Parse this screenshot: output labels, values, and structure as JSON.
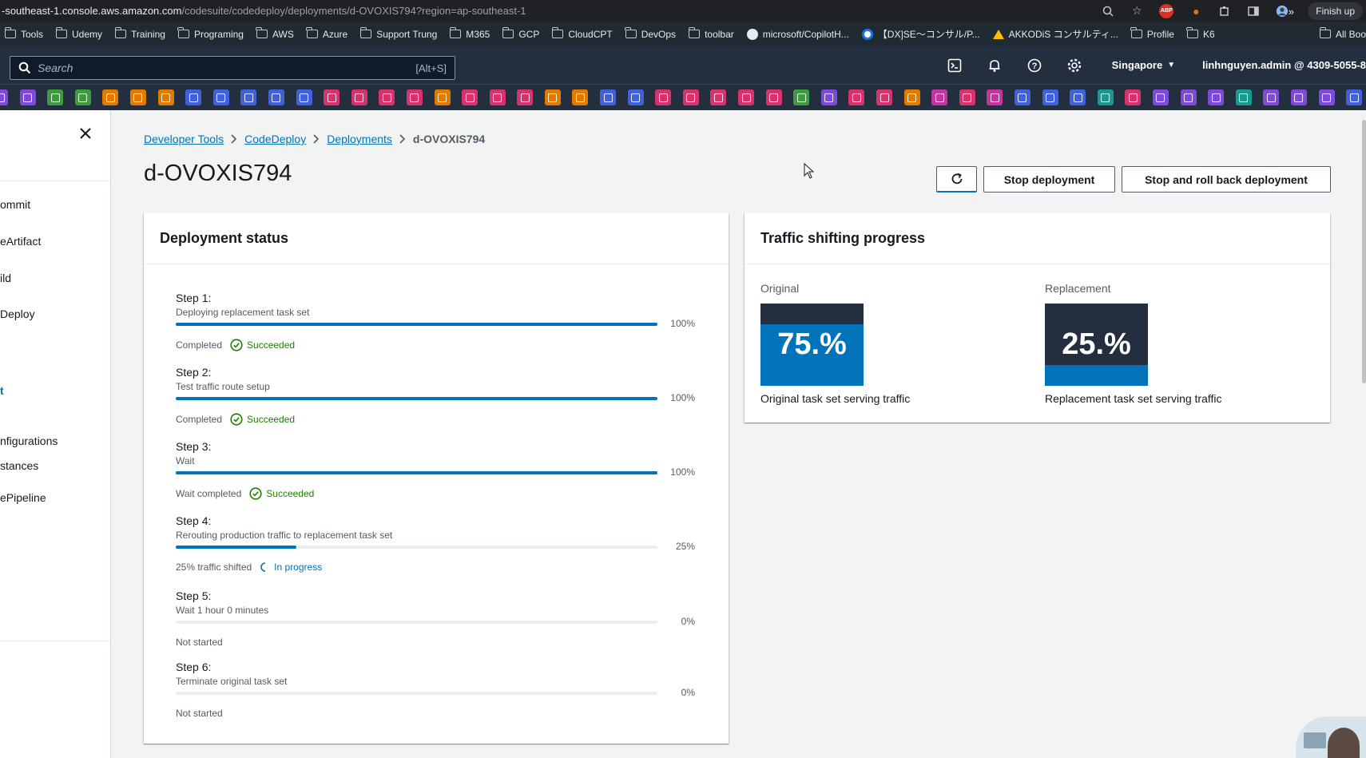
{
  "browser": {
    "url_host": "-southeast-1.console.aws.amazon.com",
    "url_path": "/codesuite/codedeploy/deployments/d-OVOXIS794?region=ap-southeast-1",
    "finish_label": "Finish up",
    "bookmarks": [
      {
        "label": "Tools",
        "icon": "folder-icon"
      },
      {
        "label": "Udemy",
        "icon": "folder-icon"
      },
      {
        "label": "Training",
        "icon": "folder-icon"
      },
      {
        "label": "Programing",
        "icon": "folder-icon"
      },
      {
        "label": "AWS",
        "icon": "folder-icon"
      },
      {
        "label": "Azure",
        "icon": "folder-icon"
      },
      {
        "label": "Support Trung",
        "icon": "folder-icon"
      },
      {
        "label": "M365",
        "icon": "folder-icon"
      },
      {
        "label": "GCP",
        "icon": "folder-icon"
      },
      {
        "label": "CloudCPT",
        "icon": "folder-icon"
      },
      {
        "label": "DevOps",
        "icon": "folder-icon"
      },
      {
        "label": "toolbar",
        "icon": "folder-icon"
      },
      {
        "label": "microsoft/CopilotH...",
        "icon": "github-icon"
      },
      {
        "label": "【DX]SE～コンサル/P...",
        "icon": "site-icon"
      },
      {
        "label": "AKKODiS コンサルティ...",
        "icon": "drive-icon"
      },
      {
        "label": "Profile",
        "icon": "folder-icon"
      },
      {
        "label": "K6",
        "icon": "folder-icon"
      }
    ],
    "more_label": "»",
    "all_bookmarks_label": "All Bookmarks"
  },
  "aws_header": {
    "search_placeholder": "Search",
    "search_shortcut": "[Alt+S]",
    "region": "Singapore",
    "account": "linhnguyen.admin @ 4309-5055-8",
    "fav_colors": [
      "#7d4bd6",
      "#7d4bd6",
      "#3f9b3f",
      "#3f9b3f",
      "#e07b00",
      "#e07b00",
      "#e07b00",
      "#4161d8",
      "#4161d8",
      "#4161d8",
      "#4161d8",
      "#4161d8",
      "#d6336c",
      "#d6336c",
      "#d6336c",
      "#d6336c",
      "#e07b00",
      "#d6336c",
      "#d6336c",
      "#d6336c",
      "#e07b00",
      "#e07b00",
      "#4161d8",
      "#4161d8",
      "#d6336c",
      "#d6336c",
      "#d6336c",
      "#d6336c",
      "#d6336c",
      "#3f9b3f",
      "#7d4bd6",
      "#d6336c",
      "#d6336c",
      "#e07b00",
      "#c2369c",
      "#d6336c",
      "#c2369c",
      "#4161d8",
      "#4161d8",
      "#4161d8",
      "#1a9a8f",
      "#d6336c",
      "#7d4bd6",
      "#7d4bd6",
      "#7d4bd6",
      "#1a9a8f",
      "#7d4bd6",
      "#7d4bd6",
      "#7d4bd6",
      "#4161d8"
    ]
  },
  "sidebar": {
    "items": [
      {
        "label": "ommit",
        "active": false
      },
      {
        "label": "eArtifact",
        "active": false
      },
      {
        "label": "ild",
        "active": false
      },
      {
        "label": "Deploy",
        "active": false
      },
      {
        "label": "t",
        "active": true
      },
      {
        "label": "nfigurations",
        "active": false
      },
      {
        "label": "stances",
        "active": false
      },
      {
        "label": "ePipeline",
        "active": false
      }
    ]
  },
  "breadcrumb": {
    "items": [
      "Developer Tools",
      "CodeDeploy",
      "Deployments"
    ],
    "current": "d-OVOXIS794"
  },
  "page": {
    "title": "d-OVOXIS794",
    "stop_label": "Stop deployment",
    "rollback_label": "Stop and roll back deployment"
  },
  "status_panel": {
    "title": "Deployment status",
    "steps": [
      {
        "title": "Step 1:",
        "desc": "Deploying replacement task set",
        "progress": 100,
        "pct": "100%",
        "status": "Completed",
        "result": "Succeeded",
        "state": "success"
      },
      {
        "title": "Step 2:",
        "desc": "Test traffic route setup",
        "progress": 100,
        "pct": "100%",
        "status": "Completed",
        "result": "Succeeded",
        "state": "success"
      },
      {
        "title": "Step 3:",
        "desc": "Wait",
        "progress": 100,
        "pct": "100%",
        "status": "Wait completed",
        "result": "Succeeded",
        "state": "success"
      },
      {
        "title": "Step 4:",
        "desc": "Rerouting production traffic to replacement task set",
        "progress": 25,
        "pct": "25%",
        "status": "25% traffic shifted",
        "result": "In progress",
        "state": "progress"
      },
      {
        "title": "Step 5:",
        "desc": "Wait 1 hour 0 minutes",
        "progress": 0,
        "pct": "0%",
        "status": "Not started",
        "result": "",
        "state": "none"
      },
      {
        "title": "Step 6:",
        "desc": "Terminate original task set",
        "progress": 0,
        "pct": "0%",
        "status": "Not started",
        "result": "",
        "state": "none"
      }
    ]
  },
  "traffic_panel": {
    "title": "Traffic shifting progress",
    "original": {
      "label": "Original",
      "value": "75.%",
      "fraction": 0.75,
      "caption": "Original task set serving traffic"
    },
    "replacement": {
      "label": "Replacement",
      "value": "25.%",
      "fraction": 0.25,
      "caption": "Replacement task set serving traffic"
    }
  },
  "colors": {
    "link": "#0073bb",
    "success": "#1d8102",
    "nav_dark": "#232f3e"
  }
}
